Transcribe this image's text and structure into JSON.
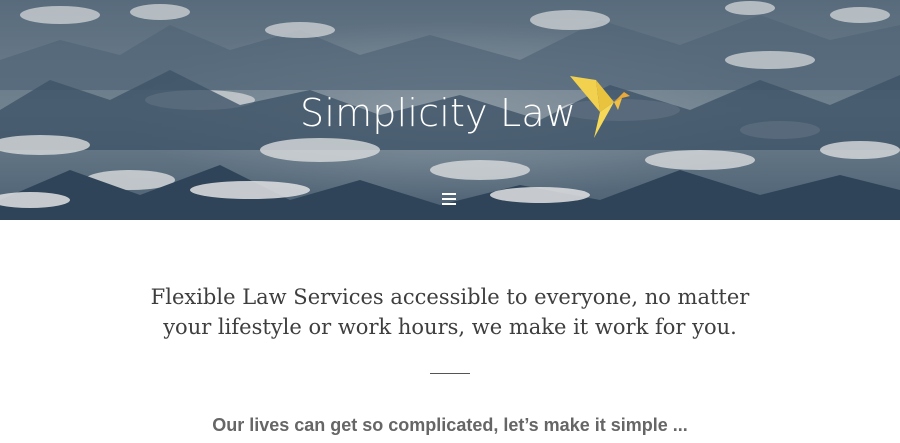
{
  "header": {
    "site_title": "Simplicity Law",
    "logo_icon": "origami-bird-icon",
    "menu_icon": "hamburger-menu-icon"
  },
  "main": {
    "tagline_line1": "Flexible Law Services accessible to everyone, no matter",
    "tagline_line2": "your lifestyle or work hours, we make it work for you.",
    "subheading": "Our lives can get so complicated, let’s make it simple ..."
  },
  "colors": {
    "logo_yellow": "#f4d24a",
    "logo_orange": "#e8a93a",
    "text_dark": "#3e3e3e",
    "text_gray": "#666666"
  }
}
